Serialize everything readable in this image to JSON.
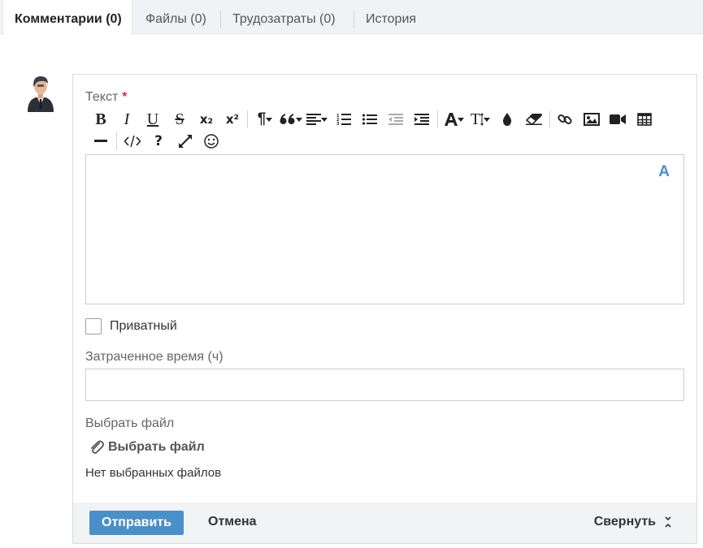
{
  "tabs": [
    {
      "label": "Комментарии (0)",
      "active": true
    },
    {
      "label": "Файлы (0)",
      "active": false
    },
    {
      "label": "Трудозатраты (0)",
      "active": false
    },
    {
      "label": "История",
      "active": false
    }
  ],
  "form": {
    "text_label": "Текст",
    "required_mark": "*",
    "editor_badge": "A",
    "private_label": "Приватный",
    "private_checked": false,
    "time_label": "Затраченное время (ч)",
    "time_value": "",
    "file_label": "Выбрать файл",
    "file_button": "Выбрать файл",
    "no_files": "Нет выбранных файлов"
  },
  "toolbar": {
    "bold": "B",
    "italic": "I",
    "underline": "U",
    "strike": "S",
    "subscript": "x₂",
    "superscript": "x²",
    "paragraph": "¶",
    "font_size": "T",
    "help": "?"
  },
  "footer": {
    "submit_label": "Отправить",
    "cancel_label": "Отмена",
    "collapse_label": "Свернуть"
  },
  "colors": {
    "accent": "#4b8fc8",
    "required": "#d9323a",
    "badge": "#4a90c8"
  }
}
